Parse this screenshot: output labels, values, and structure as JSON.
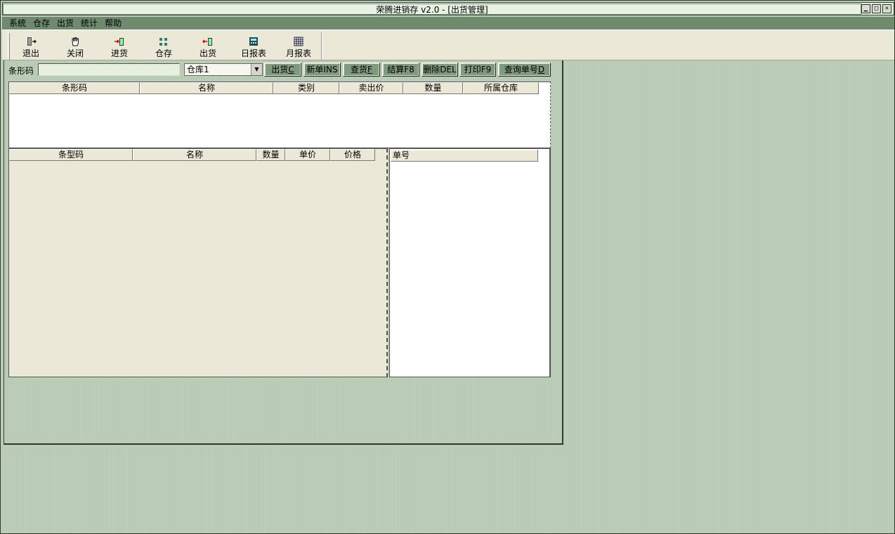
{
  "window": {
    "title": "荣腾进销存  v2.0 - [出货管理]",
    "controls": [
      "minimize-icon",
      "maximize-icon",
      "close-icon"
    ]
  },
  "menu": {
    "items": [
      "系统",
      "仓存",
      "出货",
      "统计",
      "帮助"
    ]
  },
  "toolbar": {
    "buttons": [
      {
        "label": "退出",
        "icon": "exit-door-icon"
      },
      {
        "label": "关闭",
        "icon": "hand-icon"
      },
      {
        "label": "进货",
        "icon": "stock-in-icon"
      },
      {
        "label": "仓存",
        "icon": "warehouse-grid-icon"
      },
      {
        "label": "出货",
        "icon": "stock-out-icon"
      },
      {
        "label": "日报表",
        "icon": "calculator-icon"
      },
      {
        "label": "月报表",
        "icon": "calendar-icon"
      }
    ]
  },
  "shipment": {
    "barcode_label": "条形码",
    "barcode_value": "",
    "warehouse_value": "仓库1",
    "buttons": {
      "ship": {
        "text": "出货",
        "key": "C"
      },
      "new": {
        "text": "新单INS"
      },
      "query_goods": {
        "text": "查货",
        "key": "F"
      },
      "checkout": {
        "text": "结算F8"
      },
      "delete": {
        "text": "删除DEL"
      },
      "print": {
        "text": "打印F9"
      },
      "query_order": {
        "text": "查询单号",
        "key": "D"
      }
    },
    "product_grid_headers": [
      "条形码",
      "名称",
      "类别",
      "卖出价",
      "数量",
      "所属仓库"
    ],
    "order_items_headers": [
      "条型码",
      "名称",
      "数量",
      "单价",
      "价格"
    ],
    "order_list_header": "单号"
  },
  "colors": {
    "desktop": "#b7c9b2",
    "menubar": "#6f8a6d",
    "toolbar": "#ece8d8",
    "action_button": "#7f9a7c"
  }
}
